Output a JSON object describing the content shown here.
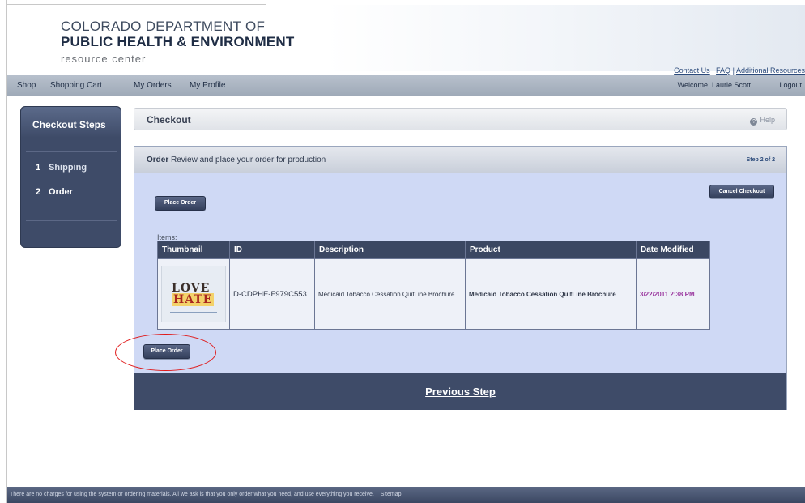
{
  "header": {
    "logo_line1": "COLORADO DEPARTMENT OF",
    "logo_line2": "PUBLIC HEALTH & ENVIRONMENT",
    "logo_line3": "resource center",
    "contact_us": "Contact Us",
    "faq": "FAQ",
    "additional_resources": "Additional Resources",
    "separator": "|"
  },
  "nav": {
    "items": [
      "Shop",
      "Shopping Cart",
      "My Orders",
      "My Profile"
    ],
    "welcome": "Welcome, Laurie Scott",
    "logout": "Logout"
  },
  "sidebar": {
    "title": "Checkout Steps",
    "steps": [
      {
        "num": "1",
        "label": "Shipping"
      },
      {
        "num": "2",
        "label": "Order"
      }
    ]
  },
  "checkout": {
    "title": "Checkout",
    "help": "Help"
  },
  "order": {
    "head_bold": "Order",
    "head_text": "Review and place your order for production",
    "step_of": "Step 2 of 2",
    "place_order": "Place Order",
    "cancel_checkout": "Cancel Checkout",
    "items_label": "Items:",
    "columns": [
      "Thumbnail",
      "ID",
      "Description",
      "Product",
      "Date Modified"
    ],
    "rows": [
      {
        "thumb_top": "LOVE",
        "thumb_bottom": "HATE",
        "id": "D-CDPHE-F979C553",
        "description": "Medicaid Tobacco Cessation QuitLine Brochure",
        "product": "Medicaid Tobacco Cessation QuitLine Brochure",
        "date_modified": "3/22/2011 2:38 PM"
      }
    ],
    "previous_step": "Previous Step"
  },
  "footer": {
    "text": "There are no charges for using the system or ordering materials. All we ask is that you only order what you need, and use everything you receive.",
    "sitemap": "Sitemap"
  },
  "colors": {
    "nav_bar": "#a7b1be",
    "panel_bg": "#cfd9f5",
    "dark_navy": "#3e4b68",
    "date_purple": "#9b3aa0",
    "annotation_red": "#e01919"
  }
}
